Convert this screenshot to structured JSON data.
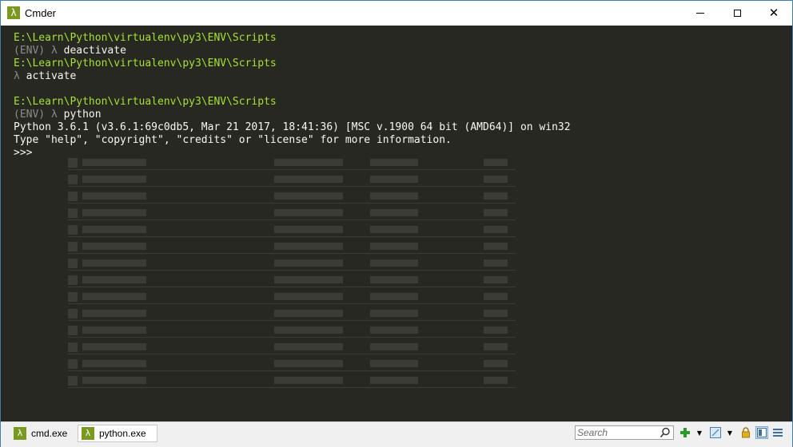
{
  "window": {
    "title": "Cmder"
  },
  "console": {
    "lines": [
      {
        "type": "path",
        "text": "E:\\Learn\\Python\\virtualenv\\py3\\ENV\\Scripts"
      },
      {
        "type": "prompt",
        "env": "(ENV) ",
        "lambda": "λ ",
        "command": "deactivate"
      },
      {
        "type": "path",
        "text": "E:\\Learn\\Python\\virtualenv\\py3\\ENV\\Scripts"
      },
      {
        "type": "prompt",
        "env": "",
        "lambda": "λ ",
        "command": "activate"
      },
      {
        "type": "blank",
        "text": ""
      },
      {
        "type": "path",
        "text": "E:\\Learn\\Python\\virtualenv\\py3\\ENV\\Scripts"
      },
      {
        "type": "prompt",
        "env": "(ENV) ",
        "lambda": "λ ",
        "command": "python"
      },
      {
        "type": "output",
        "text": "Python 3.6.1 (v3.6.1:69c0db5, Mar 21 2017, 18:41:36) [MSC v.1900 64 bit (AMD64)] on win32"
      },
      {
        "type": "output",
        "text": "Type \"help\", \"copyright\", \"credits\" or \"license\" for more information."
      },
      {
        "type": "output",
        "text": ">>>"
      }
    ]
  },
  "statusbar": {
    "tabs": [
      {
        "label": "cmd.exe",
        "icon": "lambda-icon",
        "active": false
      },
      {
        "label": "python.exe",
        "icon": "lambda-icon",
        "active": true
      }
    ],
    "search_placeholder": "Search"
  },
  "colors": {
    "terminal_bg": "#272822",
    "path_green": "#a6e22e",
    "env_gray": "#8c8c8c",
    "text": "#f8f8f2",
    "accent_green": "#7a9a1f"
  }
}
